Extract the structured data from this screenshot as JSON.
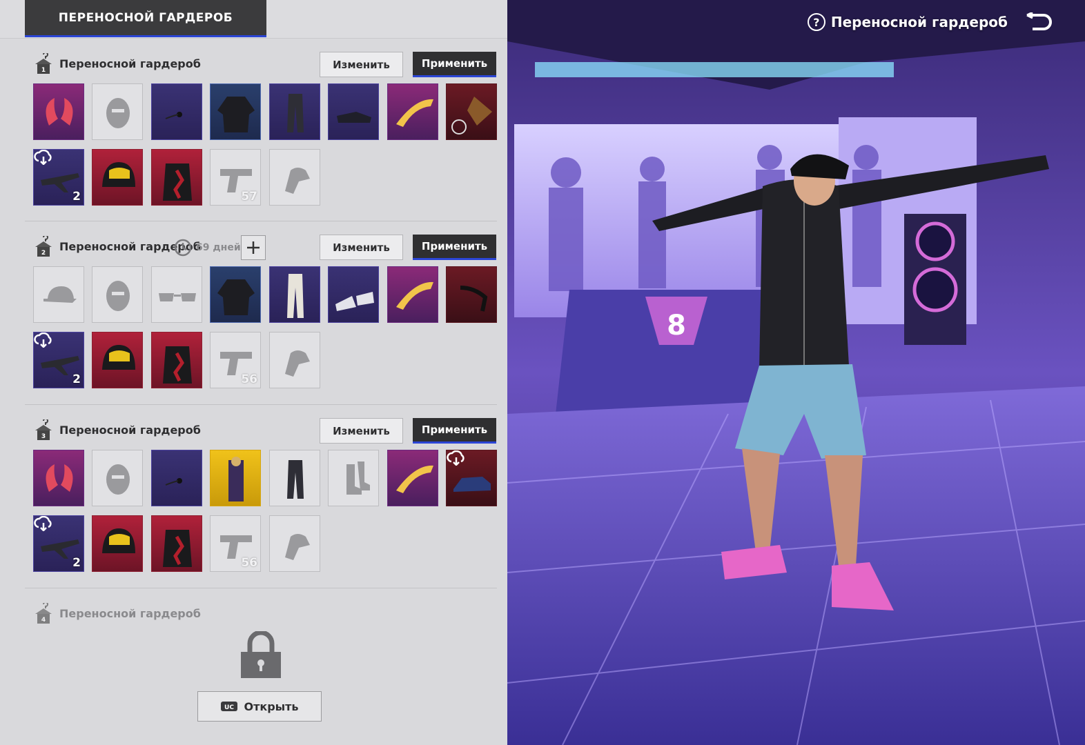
{
  "panel_tab": "ПЕРЕНОСНОЙ ГАРДЕРОБ",
  "header": {
    "title": "Переносной гардероб",
    "help_icon": "question-circle-icon",
    "back_icon": "return-arrow-icon"
  },
  "sections": [
    {
      "title": "Переносной гардероб",
      "hanger_number": "1",
      "edit_label": "Изменить",
      "apply_label": "Применить",
      "row1": [
        {
          "name": "horns-headwear-slot",
          "rarity": "magenta",
          "icon": "horns-icon"
        },
        {
          "name": "mask-slot",
          "rarity": "empty",
          "icon": "mask-icon"
        },
        {
          "name": "eyewear-slot",
          "rarity": "purple",
          "icon": "earring-icon"
        },
        {
          "name": "jacket-slot",
          "rarity": "blue",
          "icon": "jacket-icon"
        },
        {
          "name": "pants-slot",
          "rarity": "purple",
          "icon": "pants-icon"
        },
        {
          "name": "shoes-slot",
          "rarity": "purple",
          "icon": "shoes-icon"
        },
        {
          "name": "glider-slot",
          "rarity": "magenta",
          "icon": "boomerang-icon"
        },
        {
          "name": "emote-slot",
          "rarity": "darkred",
          "icon": "feather-ring-icon"
        }
      ],
      "row2": [
        {
          "name": "aircraft-slot",
          "rarity": "purple",
          "icon": "plane-icon",
          "count": "2",
          "cloud": true
        },
        {
          "name": "helmet-slot",
          "rarity": "red",
          "icon": "helmet-icon"
        },
        {
          "name": "backpack-slot",
          "rarity": "red",
          "icon": "backpack-icon"
        },
        {
          "name": "pistol-slot",
          "rarity": "empty",
          "icon": "pistol-icon",
          "count": "57"
        },
        {
          "name": "gloves-slot",
          "rarity": "empty",
          "icon": "glove-icon"
        }
      ]
    },
    {
      "title": "Переносной гардероб",
      "hanger_number": "2",
      "timer_text": "69 дней",
      "edit_label": "Изменить",
      "apply_label": "Применить",
      "row1": [
        {
          "name": "cap-slot",
          "rarity": "empty",
          "icon": "cap-icon"
        },
        {
          "name": "mask-slot",
          "rarity": "empty",
          "icon": "mask-icon"
        },
        {
          "name": "eyewear-slot",
          "rarity": "empty",
          "icon": "glasses-icon"
        },
        {
          "name": "jacket-slot",
          "rarity": "blue",
          "icon": "jacket-icon"
        },
        {
          "name": "pants-slot",
          "rarity": "purple",
          "icon": "white-pants-icon"
        },
        {
          "name": "shoes-slot",
          "rarity": "purple",
          "icon": "sneakers-icon"
        },
        {
          "name": "glider-slot",
          "rarity": "magenta",
          "icon": "boomerang-icon"
        },
        {
          "name": "emote-slot",
          "rarity": "darkred",
          "icon": "strap-icon"
        }
      ],
      "row2": [
        {
          "name": "aircraft-slot",
          "rarity": "purple",
          "icon": "plane-icon",
          "count": "2",
          "cloud": true
        },
        {
          "name": "helmet-slot",
          "rarity": "red",
          "icon": "helmet-icon"
        },
        {
          "name": "backpack-slot",
          "rarity": "red",
          "icon": "backpack-icon"
        },
        {
          "name": "pistol-slot",
          "rarity": "empty",
          "icon": "pistol-icon",
          "count": "56"
        },
        {
          "name": "gloves-slot",
          "rarity": "empty",
          "icon": "glove-icon"
        }
      ]
    },
    {
      "title": "Переносной гардероб",
      "hanger_number": "3",
      "edit_label": "Изменить",
      "apply_label": "Применить",
      "row1": [
        {
          "name": "horns-headwear-slot",
          "rarity": "magenta",
          "icon": "horns-icon"
        },
        {
          "name": "mask-slot",
          "rarity": "empty",
          "icon": "mask-icon"
        },
        {
          "name": "eyewear-slot",
          "rarity": "purple",
          "icon": "earring-icon"
        },
        {
          "name": "outfit-slot",
          "rarity": "gold",
          "icon": "outfit-icon"
        },
        {
          "name": "pants-slot",
          "rarity": "empty",
          "icon": "pants-icon"
        },
        {
          "name": "shoes-slot",
          "rarity": "empty",
          "icon": "boots-icon"
        },
        {
          "name": "glider-slot",
          "rarity": "magenta",
          "icon": "boomerang-icon"
        },
        {
          "name": "vehicle-slot",
          "rarity": "darkred",
          "icon": "car-icon",
          "cloud": true
        }
      ],
      "row2": [
        {
          "name": "aircraft-slot",
          "rarity": "purple",
          "icon": "plane-icon",
          "count": "2",
          "cloud": true
        },
        {
          "name": "helmet-slot",
          "rarity": "red",
          "icon": "helmet-icon"
        },
        {
          "name": "backpack-slot",
          "rarity": "red",
          "icon": "backpack-icon"
        },
        {
          "name": "pistol-slot",
          "rarity": "empty",
          "icon": "pistol-icon",
          "count": "56"
        },
        {
          "name": "gloves-slot",
          "rarity": "empty",
          "icon": "glove-icon"
        }
      ]
    }
  ],
  "locked_section": {
    "title": "Переносной гардероб",
    "hanger_number": "4",
    "open_label": "Открыть",
    "currency_icon": "uc-icon",
    "lock_icon": "padlock-icon"
  },
  "scene": {
    "stage_number": "8",
    "character": "player-character-pose"
  },
  "colors": {
    "accent_blue": "#2b45d6",
    "apply_dark": "#2f2f31",
    "panel_bg": "#d9d9dc"
  }
}
